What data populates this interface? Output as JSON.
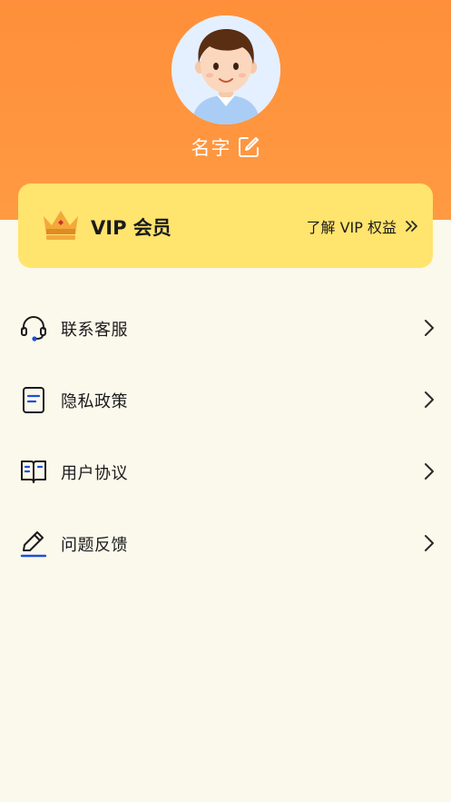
{
  "profile": {
    "name": "名字",
    "avatar_icon": "avatar-boy",
    "edit_icon": "edit-icon"
  },
  "vip": {
    "title": "VIP 会员",
    "link_label": "了解 VIP 权益",
    "icon": "crown-icon",
    "card_color": "#ffe46e"
  },
  "menu": {
    "items": [
      {
        "label": "联系客服",
        "icon": "headset-icon"
      },
      {
        "label": "隐私政策",
        "icon": "document-icon"
      },
      {
        "label": "用户协议",
        "icon": "book-icon"
      },
      {
        "label": "问题反馈",
        "icon": "pen-icon"
      }
    ]
  },
  "colors": {
    "header": "#ff9a42",
    "background": "#fbf8ec",
    "accent_blue": "#1b4fd8"
  }
}
